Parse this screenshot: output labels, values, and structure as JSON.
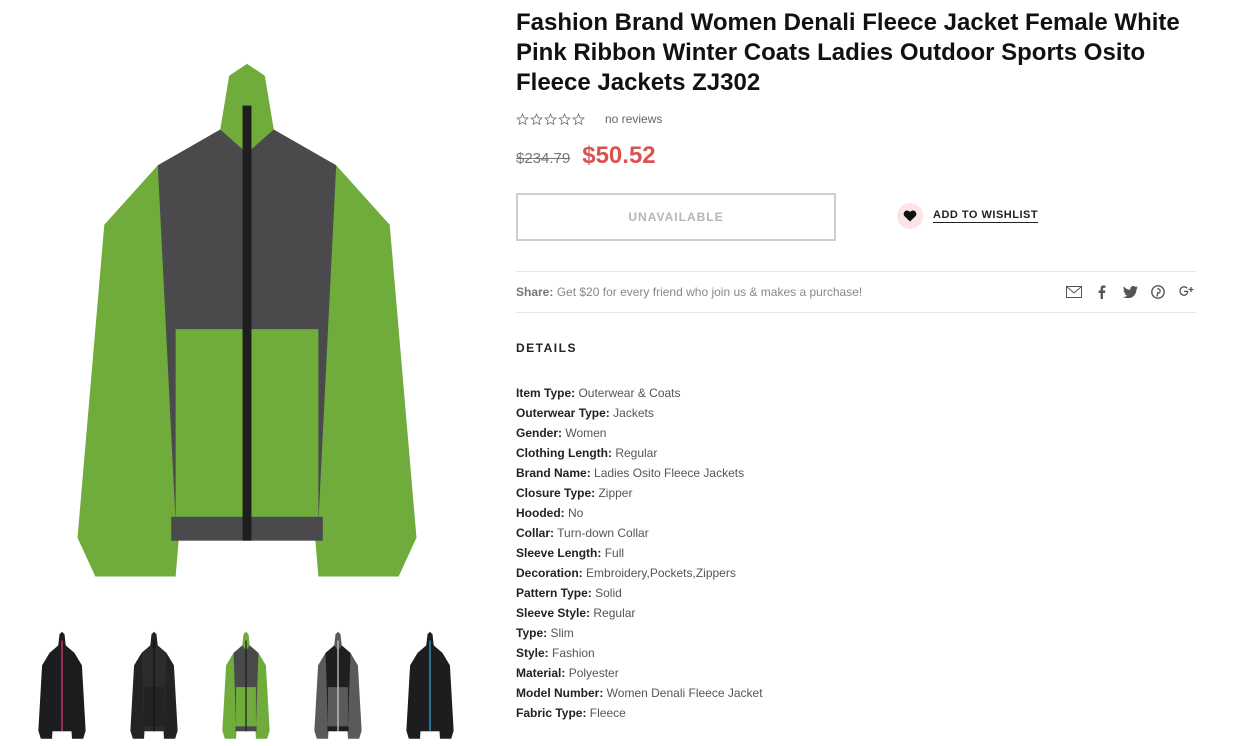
{
  "product": {
    "title": "Fashion Brand Women Denali Fleece Jacket Female White Pink Ribbon Winter Coats Ladies Outdoor Sports Osito Fleece Jackets ZJ302",
    "reviews_text": "no reviews",
    "rating": 0,
    "rating_max": 5,
    "old_price": "$234.79",
    "new_price": "$50.52",
    "price_color": "#d9534f"
  },
  "actions": {
    "unavailable_label": "UNAVAILABLE",
    "wishlist_label": "ADD TO WISHLIST",
    "wishlist_icon": "heart-icon"
  },
  "share": {
    "label": "Share:",
    "text": "Get $20 for every friend who join us & makes a purchase!",
    "icons": [
      "mail-icon",
      "facebook-icon",
      "twitter-icon",
      "pinterest-icon",
      "google-plus-icon"
    ]
  },
  "details": {
    "heading": "DETAILS",
    "specs": [
      {
        "k": "Item Type:",
        "v": " Outerwear & Coats"
      },
      {
        "k": "Outerwear Type:",
        "v": " Jackets"
      },
      {
        "k": "Gender:",
        "v": " Women"
      },
      {
        "k": "Clothing Length:",
        "v": " Regular"
      },
      {
        "k": "Brand Name:",
        "v": " Ladies Osito Fleece Jackets"
      },
      {
        "k": "Closure Type:",
        "v": " Zipper"
      },
      {
        "k": "Hooded:",
        "v": " No"
      },
      {
        "k": "Collar:",
        "v": " Turn-down Collar"
      },
      {
        "k": "Sleeve Length:",
        "v": " Full"
      },
      {
        "k": "Decoration:",
        "v": " Embroidery,Pockets,Zippers"
      },
      {
        "k": "Pattern Type:",
        "v": " Solid"
      },
      {
        "k": "Sleeve Style:",
        "v": " Regular"
      },
      {
        "k": "Type:",
        "v": " Slim"
      },
      {
        "k": "Style:",
        "v": " Fashion"
      },
      {
        "k": "Material:",
        "v": " Polyester"
      },
      {
        "k": "Model Number:",
        "v": " Women Denali Fleece Jacket"
      },
      {
        "k": "Fabric Type:",
        "v": " Fleece"
      }
    ]
  },
  "gallery": {
    "main_colors": {
      "body": "#6fac3c",
      "panel": "#4a4a4d",
      "zip": "#1e1e1e"
    },
    "thumbnails": [
      {
        "name": "thumbnail-black-pink",
        "body": "#1c1c1e",
        "panel": "#1c1c1e",
        "zip": "#e0357a"
      },
      {
        "name": "thumbnail-black",
        "body": "#232325",
        "panel": "#2c2c2e",
        "zip": "#111111"
      },
      {
        "name": "thumbnail-green",
        "body": "#6fac3c",
        "panel": "#4a4a4d",
        "zip": "#1e1e1e"
      },
      {
        "name": "thumbnail-grey-black",
        "body": "#5a5a5c",
        "panel": "#1f1f21",
        "zip": "#cfcfcf"
      },
      {
        "name": "thumbnail-black-blue",
        "body": "#1d1d1f",
        "panel": "#1d1d1f",
        "zip": "#2aa6d6"
      }
    ]
  }
}
